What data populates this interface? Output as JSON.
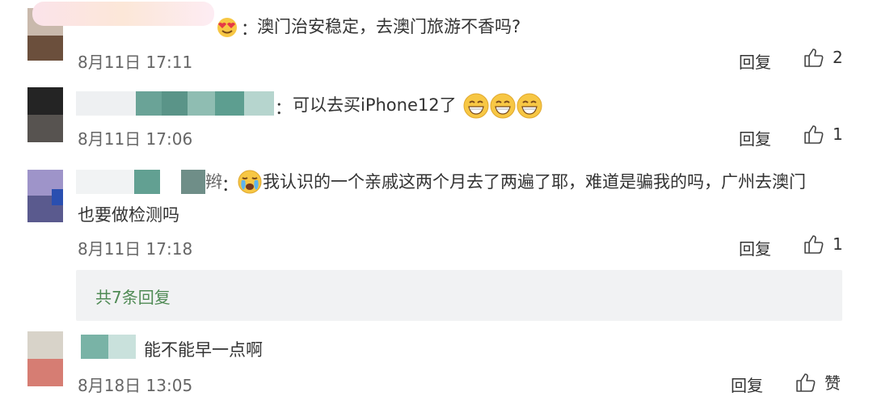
{
  "comments": [
    {
      "text": "澳门治安稳定，去澳门旅游不香吗?",
      "time": "8月11日 17:11",
      "reply": "回复",
      "likes": "2",
      "emoji": "heart-eyes-emoji"
    },
    {
      "text": "可以去买iPhone12了",
      "time": "8月11日 17:06",
      "reply": "回复",
      "likes": "1",
      "emoji": "grin-emoji"
    },
    {
      "name_fragment": "辫",
      "text_line1": "我认识的一个亲戚这两个月去了两遍了耶，难道是骗我的吗，广州去澳门",
      "text_line2": "也要做检测吗",
      "time": "8月11日 17:18",
      "reply": "回复",
      "likes": "1",
      "emoji": "crying-emoji"
    }
  ],
  "more_replies": "共7条回复",
  "last_comment": {
    "text": "能不能早一点啊",
    "time": "8月18日 13:05",
    "reply": "回复",
    "like_label": "赞"
  },
  "colors": {
    "reply_link": "#4f8a54",
    "more_bg": "#f1f2f3",
    "time": "#666666"
  }
}
